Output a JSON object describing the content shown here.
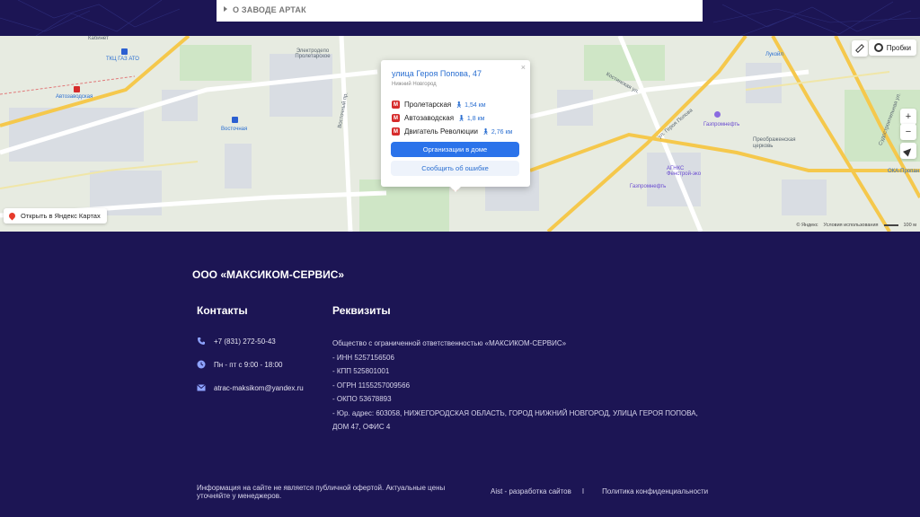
{
  "header": {
    "breadcrumb": "О ЗАВОДЕ АРТАК"
  },
  "map": {
    "popup": {
      "address": "улица Героя Попова, 47",
      "city": "Нижний Новгород",
      "close": "×",
      "stations": [
        {
          "name": "Пролетарская",
          "distance": "1,54 км"
        },
        {
          "name": "Автозаводская",
          "distance": "1,8 км"
        },
        {
          "name": "Двигатель Революции",
          "distance": "2,76 км"
        }
      ],
      "metro_letter": "M",
      "primary_button": "Организации в доме",
      "secondary_button": "Сообщить об ошибке"
    },
    "open_in_yandex": "Открыть в Яндекс Картах",
    "traffic": "Пробки",
    "zoom_in": "+",
    "zoom_out": "−",
    "attribution": "© Яндекс",
    "terms": "Условия использования",
    "scale": "100 м",
    "labels": {
      "kabinet": "Кабинет",
      "tkts": "ТКЦ ГАЗ АТО",
      "avtozavodskaya": "Автозаводская",
      "vostochnaya": "Восточная",
      "vostochny_pr": "Восточный пр.",
      "elektrodepo": "Электродепо Пролетарское",
      "geroya_popova": "ул. Героя Попова",
      "kostinskaya": "Костинская ул.",
      "gazpromneft1": "Газпромнефть",
      "gazpromneft2": "Газпромнефть",
      "agnks": "АГНКС Фенстрой-эко",
      "preobrazhenskaya": "Преображенская церковь",
      "lukoil": "Лукойл",
      "sudovaya": "Судостроительная ул.",
      "oka": "ОКА-Пропан"
    },
    "colors": {
      "primary_button": "#2b73ea",
      "metro": "#d62b2b",
      "road": "#f5c84c"
    }
  },
  "footer": {
    "company": "ООО «МАКСИКОМ-СЕРВИС»",
    "contacts_title": "Контакты",
    "phone": "+7 (831) 272-50-43",
    "hours": "Пн - пт с 9:00 - 18:00",
    "email": "atrac-maksikom@yandex.ru",
    "requisites_title": "Реквизиты",
    "requisites": [
      "Общество с ограниченной ответственностью «МАКСИКОМ-СЕРВИС»",
      "- ИНН 5257156506",
      "- КПП 525801001",
      "- ОГРН 1155257009566",
      "- ОКПО 53678893",
      "- Юр. адрес: 603058, НИЖЕГОРОДСКАЯ ОБЛАСТЬ, ГОРОД НИЖНИЙ НОВГОРОД, УЛИЦА ГЕРОЯ ПОПОВА,",
      "ДОМ 47, ОФИС 4"
    ],
    "disclaimer": "Информация на сайте не является публичной офертой. Актуальные цены уточняйте у менеджеров.",
    "developer_link": "Aist - разработка сайтов",
    "separator": "I",
    "privacy_link": "Политика конфиденциальности",
    "colors": {
      "background": "#1c1554"
    }
  }
}
